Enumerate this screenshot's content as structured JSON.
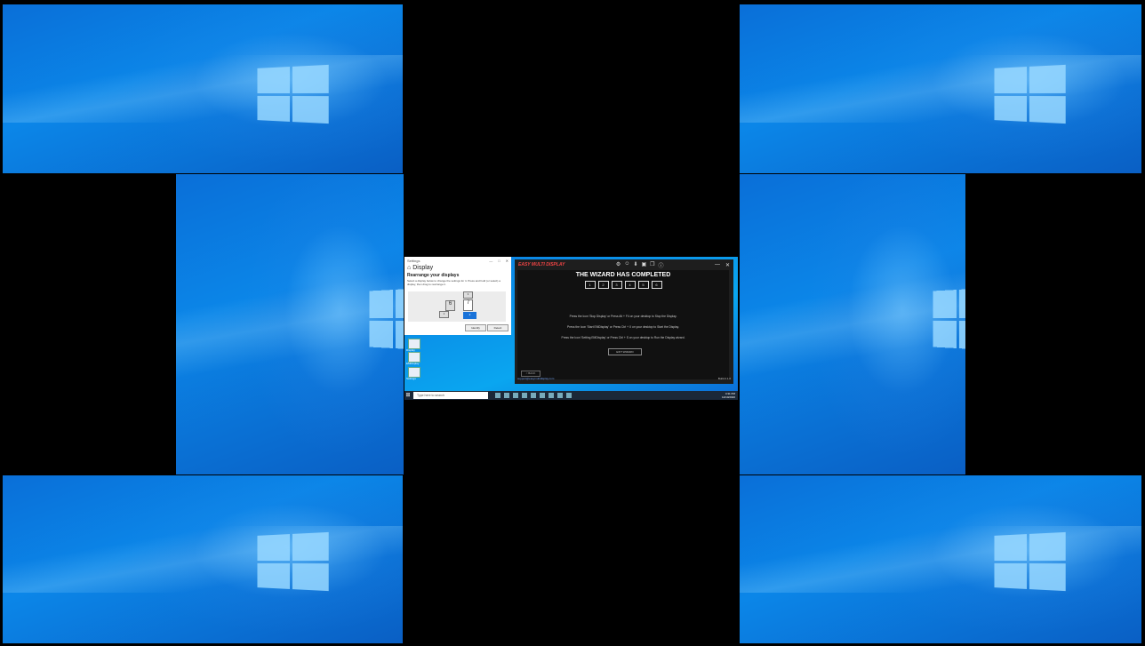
{
  "settings_window": {
    "title_bar": "Settings",
    "window_controls": [
      "—",
      "□",
      "✕"
    ],
    "page_title": "Display",
    "section_heading": "Rearrange your displays",
    "description": "Select a display below to change the settings for it. Press and hold (or select) a display, then drag to rearrange it.",
    "monitors": [
      "6",
      "7",
      "3",
      "1",
      "2"
    ],
    "identify_label": "Identify",
    "detect_label": "Detect"
  },
  "app_window": {
    "logo_text": "EASY MULTI DISPLAY",
    "window_controls": [
      "—",
      "✕"
    ],
    "toolbar_icons": [
      "settings-icon",
      "user-icon",
      "download-icon",
      "display-icon",
      "window-icon",
      "info-icon"
    ],
    "heading": "THE WIZARD HAS COMPLETED",
    "steps": [
      "1",
      "2",
      "3",
      "4",
      "5",
      "6"
    ],
    "instructions": [
      "Press the Icon 'Stop Display' or Press Alt + F4 on your desktop to Stop the Display.",
      "Press the Icon 'Start EMDisplay' or Press Ctrl + X on your desktop to Start the Display.",
      "Press the Icon 'Setting EMDisplay' or Press Ctrl + S on your desktop to Run the Display wizard."
    ],
    "exit_button": "EXIT WIZARD",
    "back_button": "< BACK",
    "status_left": "support@easymultidisplay.com",
    "status_right": "Build 2.1.0"
  },
  "desktop_icons": [
    "Display",
    "EMDisplay",
    "Settings"
  ],
  "taskbar": {
    "search_placeholder": "Type here to search",
    "clock_time": "4:31 PM",
    "clock_date": "12/10/2020"
  }
}
